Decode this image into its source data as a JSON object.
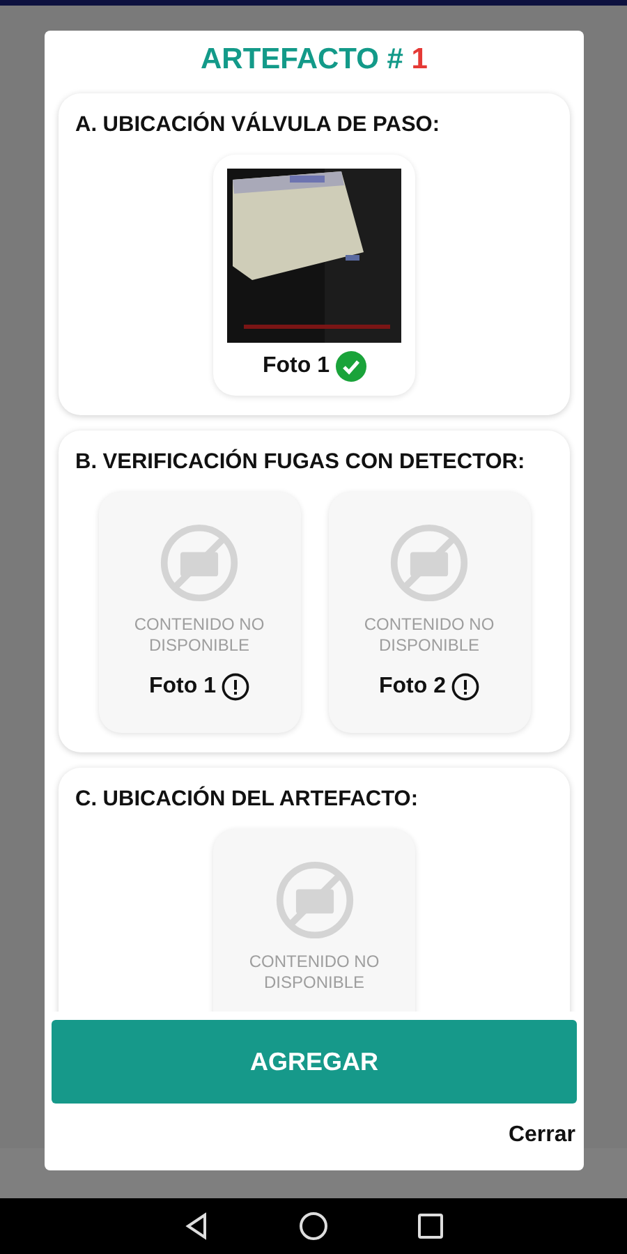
{
  "dialog": {
    "title": "ARTEFACTO #",
    "number": "1",
    "sections": [
      {
        "title": "A. UBICACIÓN VÁLVULA DE PASO:",
        "photos": [
          {
            "kind": "picture",
            "label": "Foto 1",
            "complete": true
          }
        ]
      },
      {
        "title": "B. VERIFICACIÓN FUGAS CON DETECTOR:",
        "photos": [
          {
            "kind": "unavailable",
            "message": "CONTENIDO NO DISPONIBLE",
            "label": "Foto 1",
            "complete": false
          },
          {
            "kind": "unavailable",
            "message": "CONTENIDO NO DISPONIBLE",
            "label": "Foto 2",
            "complete": false
          }
        ]
      },
      {
        "title": "C. UBICACIÓN DEL ARTEFACTO:",
        "photos": [
          {
            "kind": "unavailable",
            "message": "CONTENIDO NO DISPONIBLE"
          }
        ]
      }
    ],
    "primary_button": "AGREGAR",
    "close_link": "Cerrar"
  }
}
